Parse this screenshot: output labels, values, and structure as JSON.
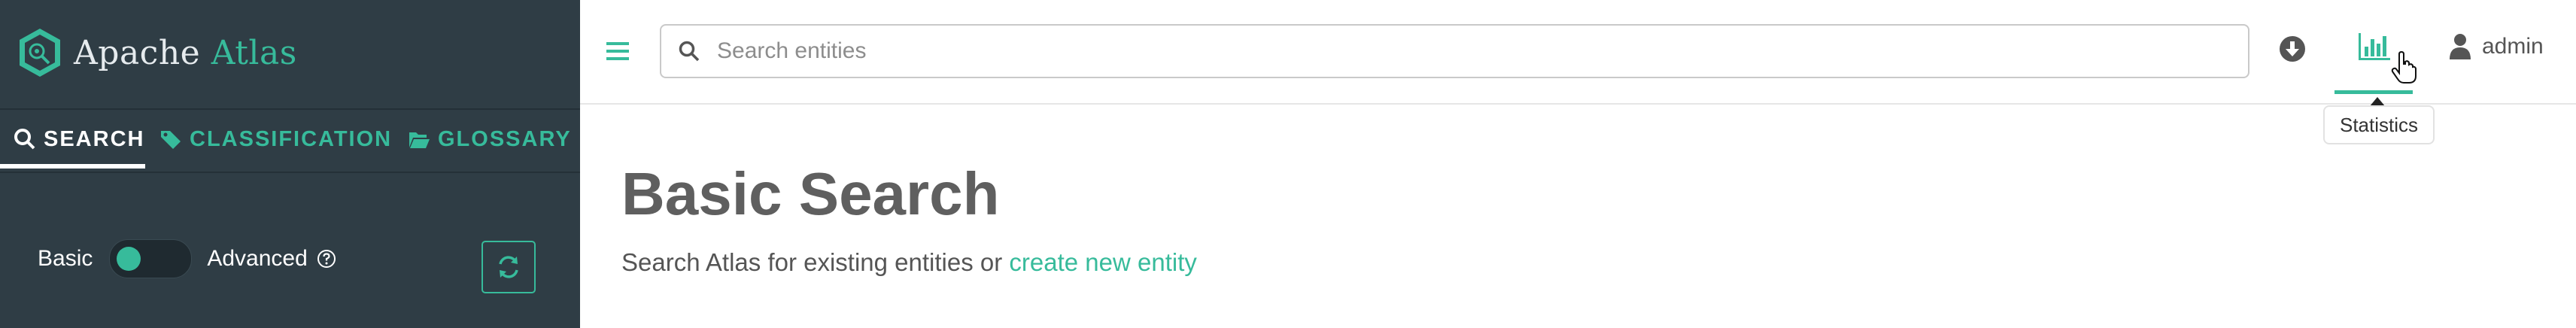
{
  "app": {
    "name_part1": "Apache",
    "name_part2": "Atlas"
  },
  "sidebar": {
    "tabs": [
      {
        "label": "SEARCH",
        "icon": "search-icon",
        "active": true
      },
      {
        "label": "CLASSIFICATION",
        "icon": "tags-icon",
        "active": false
      },
      {
        "label": "GLOSSARY",
        "icon": "folder-open-icon",
        "active": false
      }
    ],
    "mode_switch": {
      "left_label": "Basic",
      "right_label": "Advanced",
      "enabled": false
    },
    "refresh_icon": "refresh-icon"
  },
  "header": {
    "menu_icon": "hamburger-icon",
    "search_placeholder": "Search entities",
    "download_icon": "download-icon",
    "stats_icon": "bar-chart-icon",
    "stats_tooltip": "Statistics",
    "user_name": "admin"
  },
  "main": {
    "title": "Basic Search",
    "description_prefix": "Search Atlas for existing entities or",
    "create_link": "create new entity"
  },
  "colors": {
    "accent": "#37bb9b",
    "sidebar_bg": "#2f3d45",
    "text": "#5f5f5f"
  }
}
